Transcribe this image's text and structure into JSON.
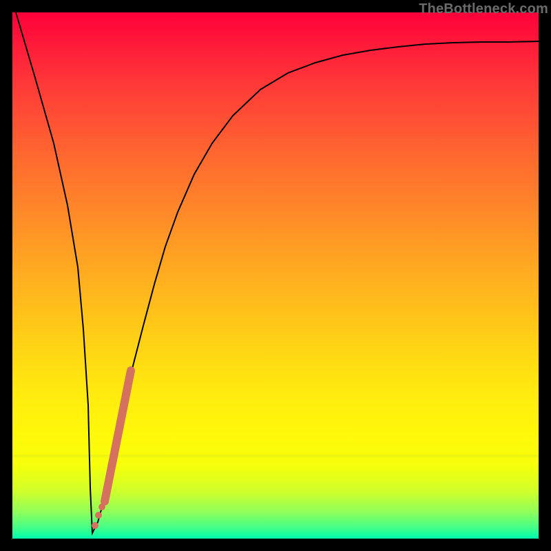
{
  "watermark": "TheBottleneck.com",
  "colors": {
    "frame": "#000000",
    "curve": "#000000",
    "marker": "#d5725f",
    "gradient_top": "#ff003a",
    "gradient_bottom": "#00ffae"
  },
  "chart_data": {
    "type": "line",
    "title": "",
    "xlabel": "",
    "ylabel": "",
    "xlim": [
      0,
      100
    ],
    "ylim": [
      0,
      100
    ],
    "grid": false,
    "series": [
      {
        "name": "bottleneck-curve",
        "x": [
          0,
          2,
          4,
          6,
          8,
          10,
          12,
          13,
          14,
          16,
          18,
          20,
          22,
          24,
          26,
          28,
          30,
          33,
          36,
          40,
          45,
          50,
          55,
          60,
          65,
          70,
          75,
          80,
          85,
          90,
          95,
          100
        ],
        "values": [
          100,
          88,
          76,
          63,
          50,
          36,
          22,
          10,
          1,
          3,
          10,
          20,
          31,
          41,
          50,
          58,
          65,
          72,
          78,
          83,
          87,
          89.5,
          91,
          92,
          92.8,
          93.4,
          93.8,
          94.1,
          94.3,
          94.5,
          94.6,
          94.7
        ]
      }
    ],
    "markers": [
      {
        "name": "highlight-segment",
        "x_range": [
          17,
          21.5
        ],
        "style": "thick-line"
      },
      {
        "name": "dot-1",
        "x": 15.8,
        "y": 3
      },
      {
        "name": "dot-2",
        "x": 16.6,
        "y": 7
      },
      {
        "name": "dot-3",
        "x": 17.2,
        "y": 12
      }
    ]
  }
}
